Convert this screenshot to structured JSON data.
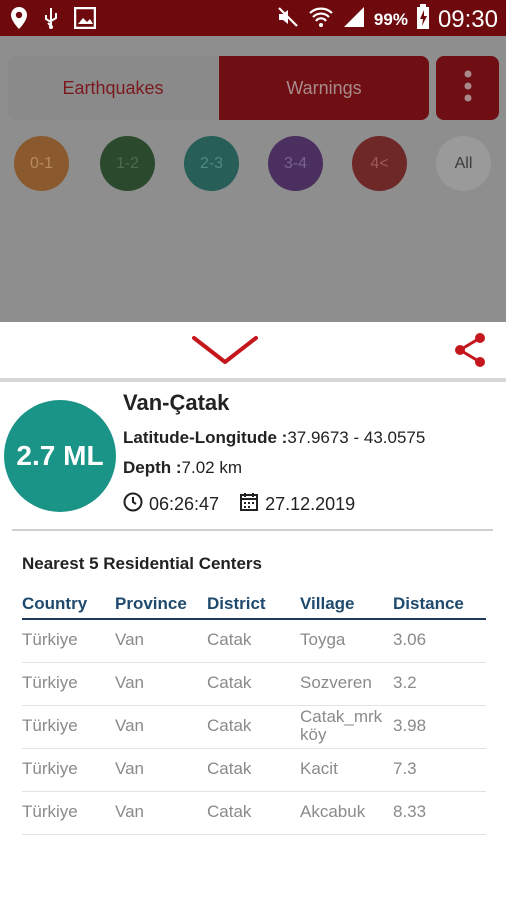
{
  "status_bar": {
    "battery_pct": "99%",
    "time": "09:30"
  },
  "tabs": {
    "earthquakes": "Earthquakes",
    "warnings": "Warnings"
  },
  "filters": [
    {
      "label": "0-1",
      "color": "#8a5a2e"
    },
    {
      "label": "1-2",
      "color": "#2b4a2d"
    },
    {
      "label": "2-3",
      "color": "#275e58"
    },
    {
      "label": "3-4",
      "color": "#4b2f5f"
    },
    {
      "label": "4<",
      "color": "#6e2828"
    },
    {
      "label": "All",
      "color": "#9a9a9a"
    }
  ],
  "event": {
    "magnitude": "2.7 ML",
    "location": "Van-Çatak",
    "latlon_label": "Latitude-Longitude :",
    "latlon_value": "37.9673 - 43.0575",
    "depth_label": "Depth :",
    "depth_value": "7.02 km",
    "time": "06:26:47",
    "date": "27.12.2019"
  },
  "nearest": {
    "title": "Nearest 5 Residential Centers",
    "headers": [
      "Country",
      "Province",
      "District",
      "Village",
      "Distance"
    ],
    "rows": [
      [
        "Türkiye",
        "Van",
        "Catak",
        "Toyga",
        "3.06"
      ],
      [
        "Türkiye",
        "Van",
        "Catak",
        "Sozveren",
        "3.2"
      ],
      [
        "Türkiye",
        "Van",
        "Catak",
        "Catak_mrkköy",
        "3.98"
      ],
      [
        "Türkiye",
        "Van",
        "Catak",
        "Kacit",
        "7.3"
      ],
      [
        "Türkiye",
        "Van",
        "Catak",
        "Akcabuk",
        "8.33"
      ]
    ]
  },
  "colors": {
    "accent": "#c4161c",
    "magnitude_bg": "#1a9487"
  }
}
